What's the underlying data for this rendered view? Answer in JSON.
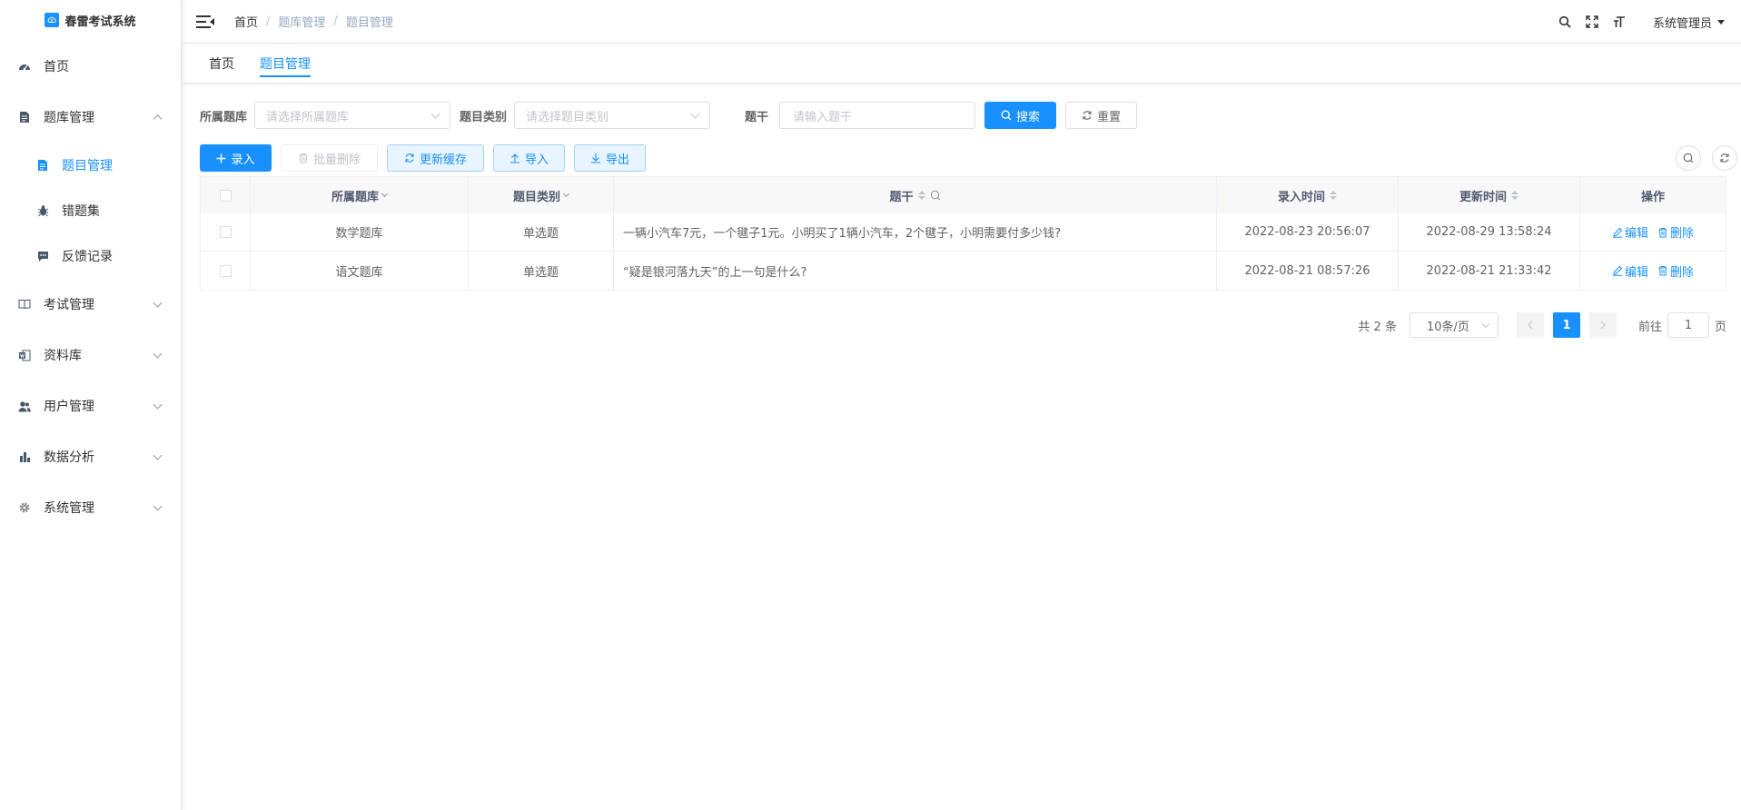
{
  "app": {
    "title": "春雷考试系统"
  },
  "colors": {
    "primary": "#1890ff",
    "text": "#303133",
    "muted": "#c0c4cc",
    "border": "#dcdfe6"
  },
  "sidebar": {
    "items": [
      {
        "label": "首页",
        "icon": "dashboard-icon"
      },
      {
        "label": "题库管理",
        "icon": "document-icon",
        "expanded": true,
        "children": [
          {
            "label": "题目管理",
            "icon": "file-icon",
            "active": true
          },
          {
            "label": "错题集",
            "icon": "bug-icon"
          },
          {
            "label": "反馈记录",
            "icon": "message-icon"
          }
        ]
      },
      {
        "label": "考试管理",
        "icon": "book-icon"
      },
      {
        "label": "资料库",
        "icon": "word-doc-icon"
      },
      {
        "label": "用户管理",
        "icon": "peoples-icon"
      },
      {
        "label": "数据分析",
        "icon": "chart-icon"
      },
      {
        "label": "系统管理",
        "icon": "gear-icon"
      }
    ]
  },
  "header": {
    "breadcrumb": [
      "首页",
      "题库管理",
      "题目管理"
    ],
    "breadcrumb_sep": "/",
    "user": "系统管理员"
  },
  "tags": [
    "首页",
    "题目管理"
  ],
  "search": {
    "bank_label": "所属题库",
    "bank_placeholder": "请选择所属题库",
    "type_label": "题目类别",
    "type_placeholder": "请选择题目类别",
    "stem_label": "题干",
    "stem_placeholder": "请输入题干",
    "search_btn": "搜索",
    "reset_btn": "重置"
  },
  "toolbar": {
    "add": "录入",
    "batch_delete": "批量删除",
    "refresh_cache": "更新缓存",
    "import": "导入",
    "export": "导出"
  },
  "table": {
    "headers": {
      "bank": "所属题库",
      "type": "题目类别",
      "stem": "题干",
      "created": "录入时间",
      "updated": "更新时间",
      "ops": "操作"
    },
    "rows": [
      {
        "bank": "数学题库",
        "type": "单选题",
        "stem": "一辆小汽车7元，一个毽子1元。小明买了1辆小汽车，2个毽子，小明需要付多少钱?",
        "created": "2022-08-23 20:56:07",
        "updated": "2022-08-29 13:58:24",
        "edit": "编辑",
        "delete": "删除"
      },
      {
        "bank": "语文题库",
        "type": "单选题",
        "stem": "“疑是银河落九天”的上一句是什么?",
        "created": "2022-08-21 08:57:26",
        "updated": "2022-08-21 21:33:42",
        "edit": "编辑",
        "delete": "删除"
      }
    ]
  },
  "pagination": {
    "total_text": "共 2 条",
    "page_size": "10条/页",
    "current_page": "1",
    "goto_prefix": "前往",
    "goto_value": "1",
    "goto_suffix": "页"
  }
}
